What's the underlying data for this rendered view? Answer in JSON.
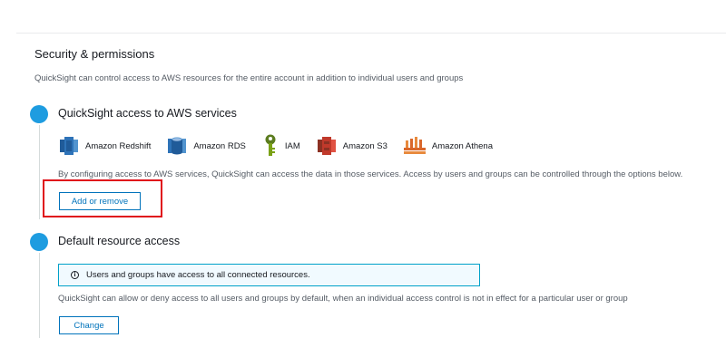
{
  "page": {
    "title": "Security & permissions",
    "description": "QuickSight can control access to AWS resources for the entire account in addition to individual users and groups"
  },
  "aws_services_step": {
    "title": "QuickSight access to AWS services",
    "services": [
      {
        "label": "Amazon Redshift",
        "icon": "amazon-redshift-icon"
      },
      {
        "label": "Amazon RDS",
        "icon": "amazon-rds-icon"
      },
      {
        "label": "IAM",
        "icon": "iam-icon"
      },
      {
        "label": "Amazon S3",
        "icon": "amazon-s3-icon"
      },
      {
        "label": "Amazon Athena",
        "icon": "amazon-athena-icon"
      }
    ],
    "description": "By configuring access to AWS services, QuickSight can access the data in those services. Access by users and groups can be controlled through the options below.",
    "button_label": "Add or remove"
  },
  "default_access_step": {
    "title": "Default resource access",
    "info_message": "Users and groups have access to all connected resources.",
    "info_icon": "i",
    "description": "QuickSight can allow or deny access to all users and groups by default, when an individual access control is not in effect for a particular user or group",
    "button_label": "Change"
  },
  "colors": {
    "step_circle": "#1e9ce0",
    "button_border": "#0073bb",
    "highlight_box": "#e0101a",
    "info_box_border": "#00a1c9",
    "info_box_background": "#f1faff"
  }
}
